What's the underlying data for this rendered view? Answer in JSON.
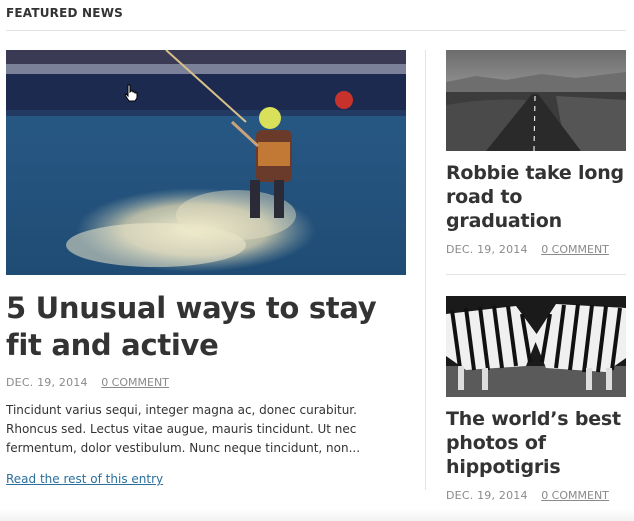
{
  "section": {
    "title": "FEATURED NEWS"
  },
  "main_article": {
    "title": "5 Unusual ways to stay fit and active",
    "date": "DEC. 19, 2014",
    "comments": "0 COMMENT",
    "excerpt": "Tincidunt varius sequi, integer magna ac, donec curabitur. Rhoncus sed. Lectus vitae augue, mauris tincidunt. Ut nec fermentum, dolor vestibulum. Nunc neque tincidunt, non...",
    "read_more": "Read the rest of this entry"
  },
  "side_articles": [
    {
      "title": "Robbie take long road to graduation",
      "date": "DEC. 19, 2014",
      "comments": "0 COMMENT"
    },
    {
      "title": "The world’s best photos of hippotigris",
      "date": "DEC. 19, 2014",
      "comments": "0 COMMENT"
    }
  ],
  "colors": {
    "text": "#333333",
    "meta": "#8a8a8a",
    "link": "#2a6f9d",
    "divider": "#e3e3e3"
  },
  "icons": {
    "cursor": "hand-pointer-icon"
  }
}
